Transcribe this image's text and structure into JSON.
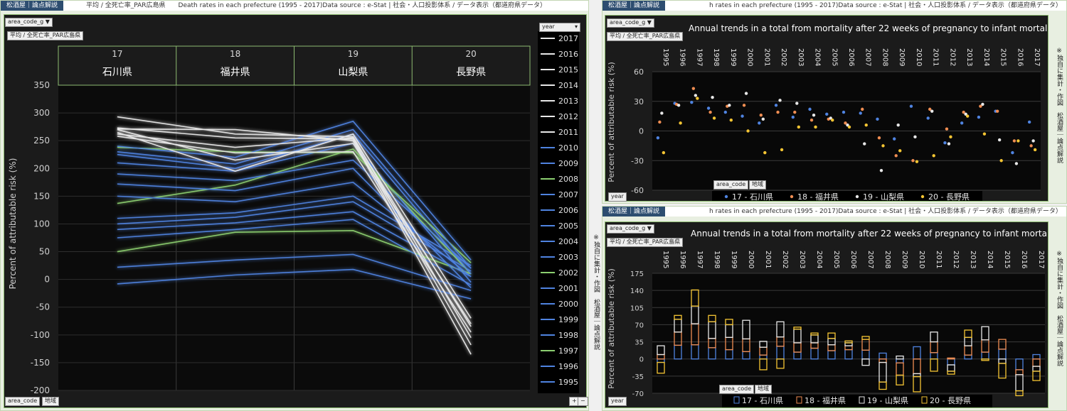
{
  "shared": {
    "brand_tab": "松酒屋｜論点解説",
    "area_code_filter": "area_code_g",
    "year_filter": "year",
    "area_code": "area_code",
    "region": "地域",
    "plus": "+",
    "minus": "−",
    "side_note": "※独自に集計・作図　松酒屋｜論点解説"
  },
  "left": {
    "tab_text": "平均 / 全死亡率_PAR広島県　　Death rates in each prefecture (1995 - 2017)Data source : e-Stat | 社会・人口投影体系 / データ表示（都道府県データ）",
    "measure_label": "平均 / 全死亡率_PAR広島県"
  },
  "right": {
    "tab_text": "h rates in each prefecture (1995 - 2017)Data source : e-Stat | 社会・人口投影体系 / データ表示（都道府県データ）",
    "measure_label": "平均 / 全死亡率_PAR広島県"
  },
  "colors": {
    "green": "#8ccf70",
    "blue": "#4f83e0",
    "orange": "#ef8d52",
    "white": "#e8e8e8",
    "yellow": "#f5c533"
  },
  "chart_data": [
    {
      "type": "line",
      "title": "",
      "ylabel": "Percent of attributable risk (%)",
      "ylim": [
        -200,
        350
      ],
      "yticks": [
        350,
        300,
        250,
        200,
        150,
        100,
        50,
        0,
        -50,
        -100,
        -150,
        -200
      ],
      "grid": true,
      "legend_title": "year",
      "legend": "right",
      "categories": [
        {
          "code": "17",
          "name": "石川県"
        },
        {
          "code": "18",
          "name": "福井県"
        },
        {
          "code": "19",
          "name": "山梨県"
        },
        {
          "code": "20",
          "name": "長野県"
        }
      ],
      "series": [
        {
          "name": "2017",
          "color": "white",
          "values": [
            271,
            270,
            250,
            -135
          ]
        },
        {
          "name": "2016",
          "color": "white",
          "values": [
            293,
            262,
            257,
            -105
          ]
        },
        {
          "name": "2015",
          "color": "white",
          "values": [
            273,
            255,
            253,
            -118
          ]
        },
        {
          "name": "2014",
          "color": "white",
          "values": [
            270,
            215,
            245,
            -80
          ]
        },
        {
          "name": "2013",
          "color": "white",
          "values": [
            265,
            195,
            262,
            -70
          ]
        },
        {
          "name": "2012",
          "color": "white",
          "values": [
            262,
            238,
            255,
            -85
          ]
        },
        {
          "name": "2011",
          "color": "white",
          "values": [
            258,
            228,
            230,
            -95
          ]
        },
        {
          "name": "2010",
          "color": "blue",
          "values": [
            240,
            220,
            285,
            35
          ]
        },
        {
          "name": "2009",
          "color": "blue",
          "values": [
            230,
            208,
            270,
            20
          ]
        },
        {
          "name": "2008",
          "color": "green",
          "values": [
            238,
            230,
            228,
            30
          ]
        },
        {
          "name": "2007",
          "color": "blue",
          "values": [
            225,
            200,
            262,
            10
          ]
        },
        {
          "name": "2006",
          "color": "blue",
          "values": [
            210,
            195,
            245,
            -5
          ]
        },
        {
          "name": "2005",
          "color": "blue",
          "values": [
            190,
            178,
            215,
            20
          ]
        },
        {
          "name": "2004",
          "color": "blue",
          "values": [
            172,
            160,
            200,
            -15
          ]
        },
        {
          "name": "2003",
          "color": "blue",
          "values": [
            150,
            140,
            175,
            5
          ]
        },
        {
          "name": "2002",
          "color": "green",
          "values": [
            137,
            170,
            235,
            10
          ]
        },
        {
          "name": "2001",
          "color": "blue",
          "values": [
            110,
            120,
            150,
            25
          ]
        },
        {
          "name": "2000",
          "color": "blue",
          "values": [
            100,
            112,
            140,
            15
          ]
        },
        {
          "name": "1999",
          "color": "blue",
          "values": [
            90,
            102,
            122,
            5
          ]
        },
        {
          "name": "1998",
          "color": "blue",
          "values": [
            75,
            90,
            108,
            -10
          ]
        },
        {
          "name": "1997",
          "color": "green",
          "values": [
            50,
            85,
            88,
            10
          ]
        },
        {
          "name": "1996",
          "color": "blue",
          "values": [
            22,
            35,
            45,
            -20
          ]
        },
        {
          "name": "1995",
          "color": "blue",
          "values": [
            -8,
            8,
            18,
            -35
          ]
        }
      ]
    },
    {
      "type": "scatter",
      "title": "Annual trends in a total from mortality after 22 weeks of pregnancy to infant mortality",
      "ylabel": "Percent of attributable risk (%)",
      "ylim": [
        -60,
        60
      ],
      "yticks": [
        60,
        30,
        0,
        -30,
        -60
      ],
      "grid": true,
      "legend": "bottom",
      "x": [
        "1995",
        "1996",
        "1997",
        "1998",
        "1999",
        "2000",
        "2001",
        "2002",
        "2003",
        "2004",
        "2005",
        "2006",
        "2007",
        "2008",
        "2009",
        "2010",
        "2011",
        "2012",
        "2013",
        "2014",
        "2015",
        "2016",
        "2017"
      ],
      "series": [
        {
          "name": "17 - 石川県",
          "color": "blue",
          "values": [
            -7,
            28,
            29,
            23,
            19,
            15,
            8,
            26,
            14,
            22,
            17,
            19,
            18,
            12,
            -8,
            25,
            13,
            -12,
            8,
            14,
            20,
            -22,
            9
          ]
        },
        {
          "name": "18 - 福井県",
          "color": "orange",
          "values": [
            9,
            27,
            43,
            19,
            25,
            26,
            16,
            19,
            19,
            11,
            12,
            8,
            22,
            -7,
            -25,
            -30,
            22,
            2,
            19,
            25,
            20,
            -10,
            -15
          ]
        },
        {
          "name": "19 - 山梨県",
          "color": "white",
          "values": [
            18,
            26,
            36,
            34,
            26,
            38,
            12,
            31,
            28,
            16,
            13,
            6,
            -13,
            -40,
            6,
            -6,
            20,
            -13,
            17,
            27,
            -9,
            -33,
            -10
          ]
        },
        {
          "name": "20 - 長野県",
          "color": "yellow",
          "values": [
            -22,
            8,
            33,
            13,
            11,
            0,
            -22,
            -19,
            4,
            4,
            11,
            4,
            6,
            -15,
            -20,
            -31,
            -25,
            -6,
            15,
            -3,
            -30,
            -10,
            -19
          ]
        }
      ]
    },
    {
      "type": "bar",
      "stacked": true,
      "title": "Annual trends in a total from mortality after 22 weeks of pregnancy to infant mortality",
      "ylabel": "Percent of attributable risk (%)",
      "ylim": [
        -70,
        175
      ],
      "yticks": [
        175,
        140,
        105,
        70,
        35,
        0,
        -35,
        -70
      ],
      "grid": true,
      "legend": "bottom",
      "x": [
        "1995",
        "1996",
        "1997",
        "1998",
        "1999",
        "2000",
        "2001",
        "2002",
        "2003",
        "2004",
        "2005",
        "2006",
        "2007",
        "2008",
        "2009",
        "2010",
        "2011",
        "2012",
        "2013",
        "2014",
        "2015",
        "2016",
        "2017"
      ],
      "series": [
        {
          "name": "17 - 石川県",
          "color": "blue",
          "values": [
            -7,
            28,
            29,
            23,
            19,
            15,
            8,
            26,
            14,
            22,
            17,
            19,
            18,
            12,
            -8,
            25,
            13,
            -12,
            8,
            14,
            20,
            -22,
            9
          ]
        },
        {
          "name": "18 - 福井県",
          "color": "orange",
          "values": [
            9,
            27,
            43,
            19,
            25,
            26,
            16,
            19,
            19,
            11,
            12,
            8,
            22,
            -7,
            -25,
            -30,
            22,
            2,
            19,
            25,
            20,
            -10,
            -15
          ]
        },
        {
          "name": "19 - 山梨県",
          "color": "white",
          "values": [
            18,
            26,
            36,
            34,
            26,
            38,
            12,
            31,
            28,
            16,
            13,
            6,
            -13,
            -40,
            6,
            -6,
            20,
            -13,
            17,
            27,
            -9,
            -33,
            -10
          ]
        },
        {
          "name": "20 - 長野県",
          "color": "yellow",
          "values": [
            -22,
            8,
            33,
            13,
            11,
            0,
            -22,
            -19,
            4,
            4,
            11,
            4,
            6,
            -15,
            -20,
            -31,
            -25,
            -6,
            15,
            -3,
            -30,
            -10,
            -19
          ]
        }
      ]
    }
  ]
}
